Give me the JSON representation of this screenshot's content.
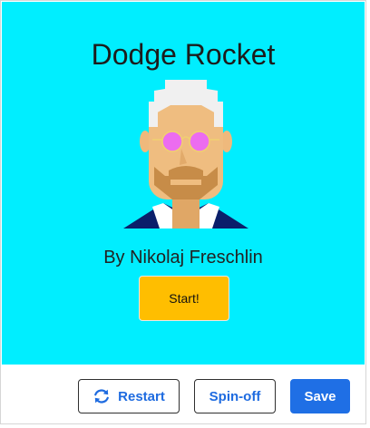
{
  "game": {
    "title": "Dodge Rocket",
    "author": "By Nikolaj Freschlin",
    "start_label": "Start!",
    "background_color": "#00eeff",
    "start_button_color": "#ffbe00"
  },
  "toolbar": {
    "restart_label": "Restart",
    "spinoff_label": "Spin-off",
    "save_label": "Save",
    "accent_color": "#1f6fe5",
    "restart_icon": "refresh-icon"
  }
}
